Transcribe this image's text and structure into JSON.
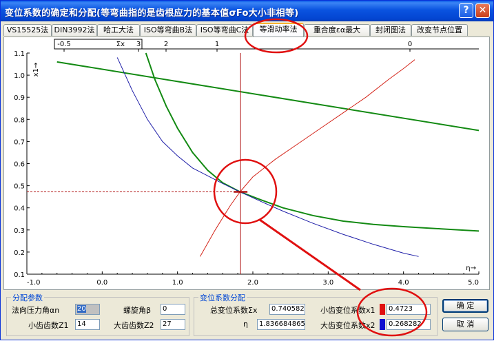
{
  "window": {
    "title": "变位系数的确定和分配(等弯曲指的是齿根应力的基本值σFo大小非相等)",
    "help_label": "?",
    "close_label": "✕"
  },
  "tabs": [
    {
      "label": "VS15525法"
    },
    {
      "label": "DIN3992法"
    },
    {
      "label": "哈工大法"
    },
    {
      "label": "ISO等弯曲B法"
    },
    {
      "label": "ISO等弯曲C法"
    },
    {
      "label": "等滑动率法"
    },
    {
      "label": "重合度εα最大"
    },
    {
      "label": "封闭图法"
    },
    {
      "label": "改变节点位置"
    }
  ],
  "active_tab": "等滑动率法",
  "chart_data": {
    "type": "line",
    "xlabel": "η→",
    "ylabel": "x1→",
    "xlim": [
      -1.0,
      5.0
    ],
    "ylim": [
      0.1,
      1.1
    ],
    "x_ticks": [
      "-1.0",
      "0.0",
      "1.0",
      "2.0",
      "3.0",
      "4.0",
      "5.0"
    ],
    "y_ticks": [
      "0.1",
      "0.2",
      "0.3",
      "0.4",
      "0.5",
      "0.6",
      "0.7",
      "0.8",
      "0.9",
      "1.0",
      "1.1"
    ],
    "top_axis": {
      "label": "Σx",
      "ticks": [
        "-0.5",
        "3",
        "2",
        "1",
        "0"
      ]
    },
    "grid": false,
    "series": [
      {
        "color": "#138a13",
        "x": [
          -0.6,
          5.0
        ],
        "y": [
          1.06,
          0.75
        ]
      },
      {
        "color": "#138a13",
        "x": [
          0.58,
          0.7,
          0.85,
          1.0,
          1.2,
          1.4,
          1.6,
          1.83,
          2.1,
          2.4,
          2.8,
          3.2,
          3.6,
          4.0,
          4.5,
          5.0
        ],
        "y": [
          1.1,
          0.98,
          0.86,
          0.76,
          0.65,
          0.57,
          0.513,
          0.4723,
          0.437,
          0.4,
          0.365,
          0.34,
          0.325,
          0.315,
          0.305,
          0.295
        ]
      },
      {
        "color": "#1f1fa8",
        "x": [
          0.2,
          0.4,
          0.6,
          0.8,
          1.0,
          1.2,
          1.4,
          1.6,
          1.83,
          2.1,
          2.4,
          2.8,
          3.2,
          3.6,
          4.0,
          4.2
        ],
        "y": [
          1.08,
          0.93,
          0.8,
          0.7,
          0.635,
          0.58,
          0.545,
          0.51,
          0.4723,
          0.43,
          0.385,
          0.33,
          0.28,
          0.235,
          0.195,
          0.18
        ]
      },
      {
        "color": "#d4251a",
        "x": [
          1.3,
          1.5,
          1.7,
          1.83,
          2.0,
          2.3,
          2.6,
          2.9,
          3.2,
          3.5,
          3.8,
          4.0,
          4.15
        ],
        "y": [
          0.18,
          0.3,
          0.41,
          0.4723,
          0.54,
          0.62,
          0.69,
          0.76,
          0.83,
          0.9,
          0.98,
          1.03,
          1.07
        ]
      }
    ],
    "markers": {
      "eta": 1.836684865,
      "x1": 0.4723,
      "color": "#b01010"
    }
  },
  "params": {
    "title": "分配参数",
    "pressure_angle_label": "法向压力角αn",
    "pressure_angle_value": "20",
    "helix_angle_label": "螺旋角β",
    "helix_angle_value": "0",
    "z1_label": "小齿齿数Z1",
    "z1_value": "14",
    "z2_label": "大齿齿数Z2",
    "z2_value": "27"
  },
  "distribution": {
    "title": "变位系数分配",
    "sum_x_label": "总变位系数Σx",
    "sum_x_value": "0.740582",
    "eta_label": "η",
    "eta_value": "1.836684865",
    "x1_label": "小齿变位系数x1",
    "x1_value": "0.4723",
    "x1_color": "#e01010",
    "x2_label": "大齿变位系数x2",
    "x2_value": "0.268282",
    "x2_color": "#1010d0"
  },
  "buttons": {
    "ok_label": "确 定",
    "cancel_label": "取 消"
  },
  "annotation_color": "#e01010"
}
